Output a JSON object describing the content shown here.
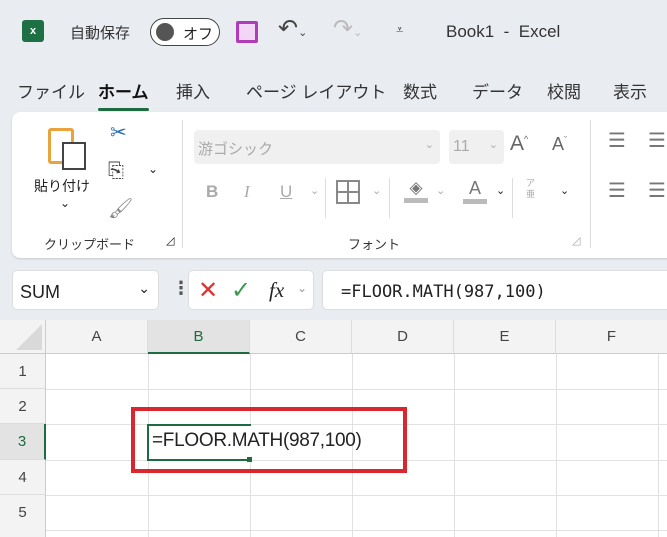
{
  "titlebar": {
    "autosave_label": "自動保存",
    "autosave_state": "オフ",
    "title": "Book1  -  Excel"
  },
  "tabs": [
    {
      "label": "ファイル"
    },
    {
      "label": "ホーム",
      "active": true
    },
    {
      "label": "挿入"
    },
    {
      "label": "ページ レイアウト"
    },
    {
      "label": "数式"
    },
    {
      "label": "データ"
    },
    {
      "label": "校閲"
    },
    {
      "label": "表示"
    }
  ],
  "ribbon": {
    "clipboard": {
      "paste_label": "貼り付け",
      "group_label": "クリップボード"
    },
    "font": {
      "font_name": "游ゴシック",
      "font_size": "11",
      "group_label": "フォント",
      "bold": "B",
      "italic": "I",
      "underline": "U",
      "font_color": "A",
      "grow": "A",
      "shrink": "A",
      "phonetic_top": "ア",
      "phonetic_bottom": "亜"
    }
  },
  "formula_bar": {
    "name_box": "SUM",
    "fx": "fx",
    "formula": "=FLOOR.MATH(987,100)"
  },
  "sheet": {
    "columns": [
      "A",
      "B",
      "C",
      "D",
      "E",
      "F"
    ],
    "rows": [
      "1",
      "2",
      "3",
      "4",
      "5"
    ],
    "active_cell": "B3",
    "cell_b3": "=FLOOR.MATH(987,100)"
  },
  "colors": {
    "accent": "#1e6b41",
    "highlight": "#d9262f",
    "save_icon": "#b03cb8"
  }
}
